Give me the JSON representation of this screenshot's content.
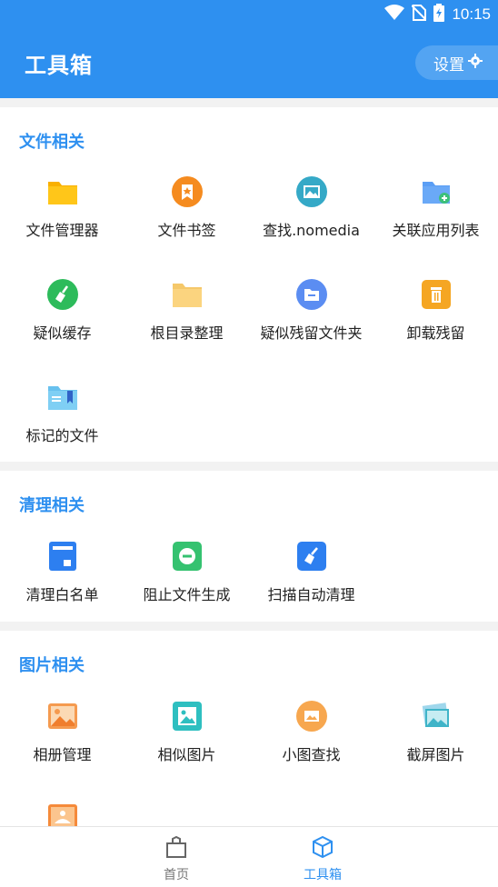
{
  "status_bar": {
    "time": "10:15"
  },
  "app_bar": {
    "title": "工具箱",
    "settings_label": "设置"
  },
  "sections": [
    {
      "title": "文件相关",
      "items": [
        {
          "label": "文件管理器",
          "icon": "folder-icon"
        },
        {
          "label": "文件书签",
          "icon": "bookmark-icon"
        },
        {
          "label": "查找.nomedia",
          "icon": "image-search-icon"
        },
        {
          "label": "关联应用列表",
          "icon": "folder-add-icon"
        },
        {
          "label": "疑似缓存",
          "icon": "broom-icon"
        },
        {
          "label": "根目录整理",
          "icon": "folder-open-icon"
        },
        {
          "label": "疑似残留文件夹",
          "icon": "residual-folder-icon"
        },
        {
          "label": "卸载残留",
          "icon": "trash-icon"
        },
        {
          "label": "标记的文件",
          "icon": "marked-folder-icon"
        }
      ]
    },
    {
      "title": "清理相关",
      "items": [
        {
          "label": "清理白名单",
          "icon": "whitelist-icon"
        },
        {
          "label": "阻止文件生成",
          "icon": "block-icon"
        },
        {
          "label": "扫描自动清理",
          "icon": "auto-clean-icon"
        }
      ]
    },
    {
      "title": "图片相关",
      "items": [
        {
          "label": "相册管理",
          "icon": "album-icon"
        },
        {
          "label": "相似图片",
          "icon": "similar-image-icon"
        },
        {
          "label": "小图查找",
          "icon": "small-image-icon"
        },
        {
          "label": "截屏图片",
          "icon": "screenshot-icon"
        }
      ]
    }
  ],
  "bottom_nav": {
    "home_label": "首页",
    "toolbox_label": "工具箱",
    "active": "工具箱"
  },
  "colors": {
    "primary": "#2e90f0",
    "section_title": "#2e90f0"
  }
}
